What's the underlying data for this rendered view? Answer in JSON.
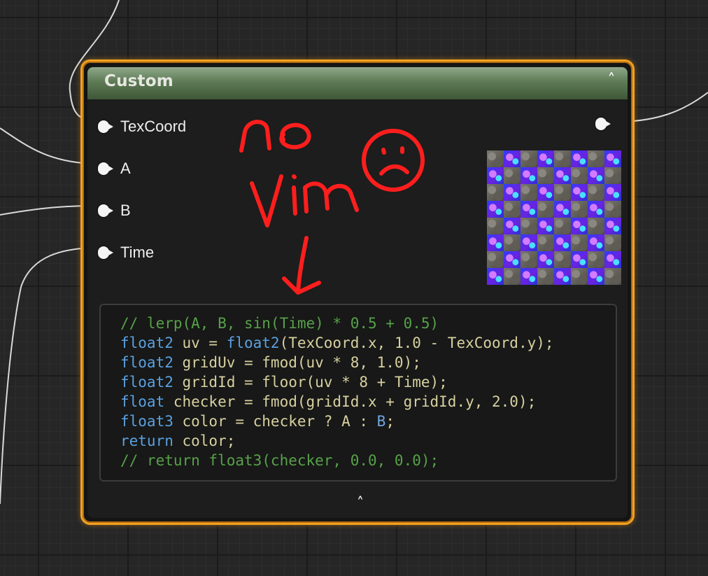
{
  "node": {
    "title": "Custom",
    "collapse_icon": "chevron-up-icon",
    "footer_icon": "chevron-up-icon",
    "border_color": "#f3a020",
    "header_color": "#5d7b55",
    "inputs": [
      {
        "label": "TexCoord"
      },
      {
        "label": "A"
      },
      {
        "label": "B"
      },
      {
        "label": "Time"
      }
    ],
    "output": {
      "label": ""
    }
  },
  "code": {
    "lines": [
      [
        {
          "t": "// lerp(A, B, sin(Time) * 0.5 + 0.5)",
          "c": "comment"
        }
      ],
      [
        {
          "t": "float2",
          "c": "type"
        },
        {
          "t": " uv = ",
          "c": "text"
        },
        {
          "t": "float2",
          "c": "type"
        },
        {
          "t": "(TexCoord.x, 1.0 - TexCoord.y);",
          "c": "text"
        }
      ],
      [
        {
          "t": "float2",
          "c": "type"
        },
        {
          "t": " gridUv = fmod(uv * 8, 1.0);",
          "c": "text"
        }
      ],
      [
        {
          "t": "float2",
          "c": "type"
        },
        {
          "t": " gridId = floor(uv * 8 + Time);",
          "c": "text"
        }
      ],
      [
        {
          "t": "float",
          "c": "type"
        },
        {
          "t": " checker = fmod(gridId.x + gridId.y, 2.0);",
          "c": "text"
        }
      ],
      [
        {
          "t": "float3",
          "c": "type"
        },
        {
          "t": " color = checker ? ",
          "c": "text"
        },
        {
          "t": "A",
          "c": "text"
        },
        {
          "t": " : ",
          "c": "text"
        },
        {
          "t": "B",
          "c": "var"
        },
        {
          "t": ";",
          "c": "text"
        }
      ],
      [
        {
          "t": "return",
          "c": "type"
        },
        {
          "t": " color;",
          "c": "text"
        }
      ],
      [
        {
          "t": "// return float3(checker, 0.0, 0.0);",
          "c": "comment"
        }
      ]
    ]
  },
  "preview": {
    "pattern": "checker",
    "grid": 8
  },
  "annotation": {
    "handwritten_text": "no Vim",
    "drawn_icon": "frown-face-icon",
    "arrow_icon": "down-arrow-icon",
    "color": "#ff1e1e"
  }
}
